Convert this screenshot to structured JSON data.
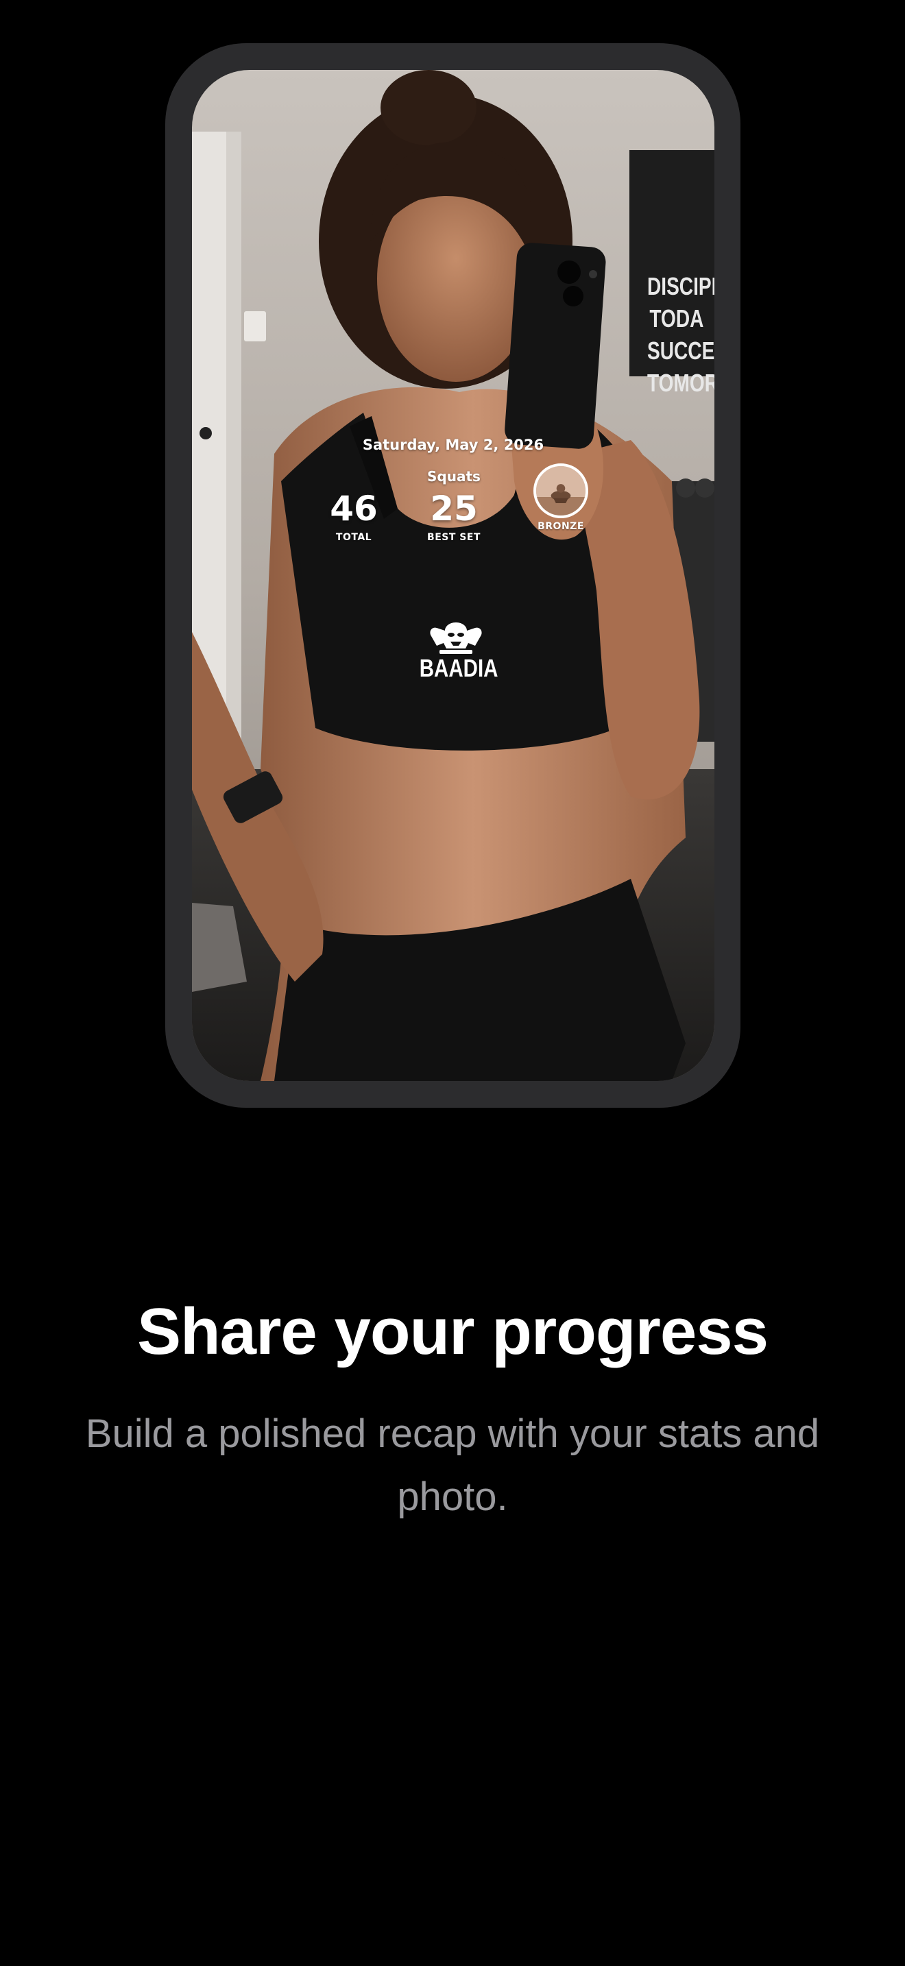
{
  "onboarding": {
    "title": "Share your progress",
    "subtitle": "Build a polished recap with your stats and photo."
  },
  "recap": {
    "date": "Saturday, May 2, 2026",
    "exercise": "Squats",
    "stats": {
      "total_value": "46",
      "total_label": "TOTAL",
      "best_value": "25",
      "best_label": "BEST SET"
    },
    "badge": {
      "label": "BRONZE",
      "icon": "bronze-medal-icon"
    },
    "brand": {
      "name": "BAADIA",
      "icon": "muscle-mascot-icon"
    }
  },
  "photo": {
    "description_icon": "gym-selfie-photo",
    "poster_lines": [
      "DISCIPL",
      "TODA",
      "SUCCE",
      "TOMORI"
    ]
  },
  "colors": {
    "background": "#000000",
    "frame": "#2c2c2e",
    "title": "#ffffff",
    "subtitle": "#9a9a9e"
  }
}
